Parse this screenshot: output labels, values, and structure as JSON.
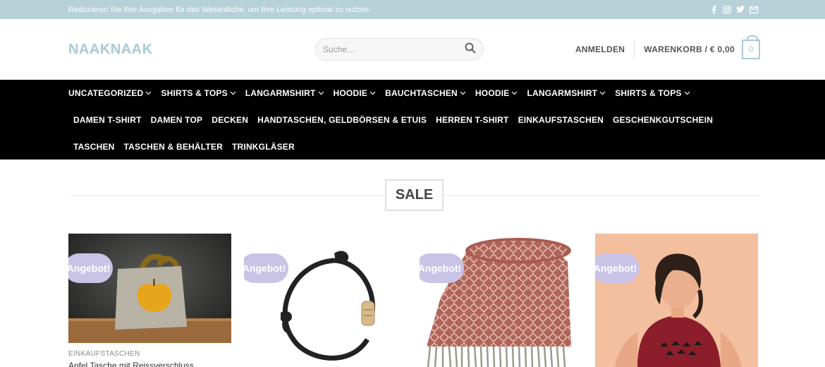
{
  "topbar": {
    "message": "Reduzieren Sie Ihre Ausgaben für das Wesentliche, um Ihre Leistung optimal zu nutzen.",
    "social_icons": [
      "facebook-icon",
      "instagram-icon",
      "twitter-icon",
      "envelope-icon"
    ]
  },
  "header": {
    "logo": "NAAKNAAK",
    "search_placeholder": "Suche…",
    "login": "ANMELDEN",
    "cart": "WARENKORB / € 0,00",
    "cart_count": "0"
  },
  "nav": {
    "row1": [
      "UNCATEGORIZED",
      "SHIRTS & TOPS",
      "LANGARMSHIRT",
      "HOODIE",
      "BAUCHTASCHEN",
      "HOODIE",
      "LANGARMSHIRT",
      "SHIRTS & TOPS"
    ],
    "row2": [
      "DAMEN T-SHIRT",
      "DAMEN TOP",
      "DECKEN",
      "HANDTASCHEN, GELDBÖRSEN & ETUIS",
      "HERREN T-SHIRT",
      "EINKAUFSTASCHEN",
      "GESCHENKGUTSCHEIN"
    ],
    "row3": [
      "TASCHEN",
      "TASCHEN & BEHÄLTER",
      "TRINKGLÄSER"
    ]
  },
  "section": {
    "title": "SALE"
  },
  "products": [
    {
      "badge": "Angebot!",
      "category": "EINKAUFSTASCHEN",
      "title": "Apfel Tasche mit Reissverschluss"
    },
    {
      "badge": "Angebot!",
      "category": "",
      "title": ""
    },
    {
      "badge": "Angebot!",
      "category": "",
      "title": ""
    },
    {
      "badge": "Angebot!",
      "category": "",
      "title": ""
    }
  ],
  "colors": {
    "topbar": "#b7d1d9",
    "accent": "#a9cad4",
    "nav_bg": "#000000",
    "badge": "#c9c3e6"
  }
}
